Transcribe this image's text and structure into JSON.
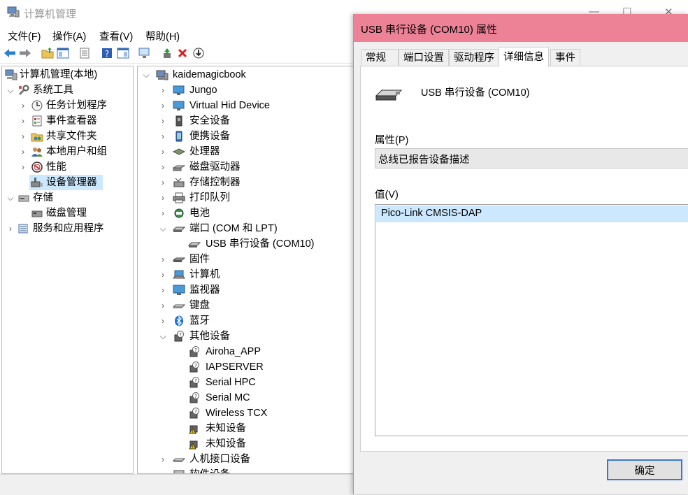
{
  "window": {
    "title": "计算机管理",
    "minimize": "—",
    "maximize": "☐",
    "close": "✕"
  },
  "menu": [
    "文件(F)",
    "操作(A)",
    "查看(V)",
    "帮助(H)"
  ],
  "left_tree": [
    {
      "label": "计算机管理(本地)",
      "icon": "computer-management-icon"
    },
    {
      "label": "系统工具",
      "icon": "tools-icon"
    },
    {
      "label": "任务计划程序",
      "icon": "clock-icon"
    },
    {
      "label": "事件查看器",
      "icon": "event-viewer-icon"
    },
    {
      "label": "共享文件夹",
      "icon": "shared-folder-icon"
    },
    {
      "label": "本地用户和组",
      "icon": "users-icon"
    },
    {
      "label": "性能",
      "icon": "performance-icon"
    },
    {
      "label": "设备管理器",
      "icon": "device-manager-icon"
    },
    {
      "label": "存储",
      "icon": "storage-icon"
    },
    {
      "label": "磁盘管理",
      "icon": "disk-icon"
    },
    {
      "label": "服务和应用程序",
      "icon": "services-icon"
    }
  ],
  "device_tree": [
    {
      "label": "kaidemagicbook",
      "icon": "computer-icon"
    },
    {
      "label": "Jungo",
      "icon": "monitor-icon"
    },
    {
      "label": "Virtual Hid Device",
      "icon": "monitor-icon"
    },
    {
      "label": "安全设备",
      "icon": "security-device-icon"
    },
    {
      "label": "便携设备",
      "icon": "portable-device-icon"
    },
    {
      "label": "处理器",
      "icon": "processor-icon"
    },
    {
      "label": "磁盘驱动器",
      "icon": "disk-drive-icon"
    },
    {
      "label": "存储控制器",
      "icon": "storage-controller-icon"
    },
    {
      "label": "打印队列",
      "icon": "printer-icon"
    },
    {
      "label": "电池",
      "icon": "battery-icon"
    },
    {
      "label": "端口 (COM 和 LPT)",
      "icon": "port-icon"
    },
    {
      "label": "USB 串行设备 (COM10)",
      "icon": "port-icon"
    },
    {
      "label": "固件",
      "icon": "firmware-icon"
    },
    {
      "label": "计算机",
      "icon": "computer-icon"
    },
    {
      "label": "监视器",
      "icon": "monitor-icon"
    },
    {
      "label": "键盘",
      "icon": "keyboard-icon"
    },
    {
      "label": "蓝牙",
      "icon": "bluetooth-icon"
    },
    {
      "label": "其他设备",
      "icon": "unknown-device-icon"
    },
    {
      "label": "Airoha_APP",
      "icon": "unknown-device-icon"
    },
    {
      "label": "IAPSERVER",
      "icon": "unknown-device-icon"
    },
    {
      "label": "Serial HPC",
      "icon": "unknown-device-icon"
    },
    {
      "label": "Serial MC",
      "icon": "unknown-device-icon"
    },
    {
      "label": "Wireless TCX",
      "icon": "unknown-device-icon"
    },
    {
      "label": "未知设备",
      "icon": "warning-device-icon"
    },
    {
      "label": "未知设备",
      "icon": "warning-device-icon"
    },
    {
      "label": "人机接口设备",
      "icon": "hid-icon"
    },
    {
      "label": "软件设备",
      "icon": "software-device-icon"
    }
  ],
  "dialog": {
    "title": "USB 串行设备 (COM10) 属性",
    "tabs": [
      "常规",
      "端口设置",
      "驱动程序",
      "详细信息",
      "事件"
    ],
    "active_tab": "详细信息",
    "device_name": "USB 串行设备 (COM10)",
    "property_label": "属性(P)",
    "property_value": "总线已报告设备描述",
    "value_label": "值(V)",
    "value_item": "Pico-Link CMSIS-DAP",
    "ok_button": "确定"
  },
  "colors": {
    "dialog_title_bg": "#ed8196",
    "selection": "#cce8ff",
    "ok_border": "#3a78d8"
  }
}
